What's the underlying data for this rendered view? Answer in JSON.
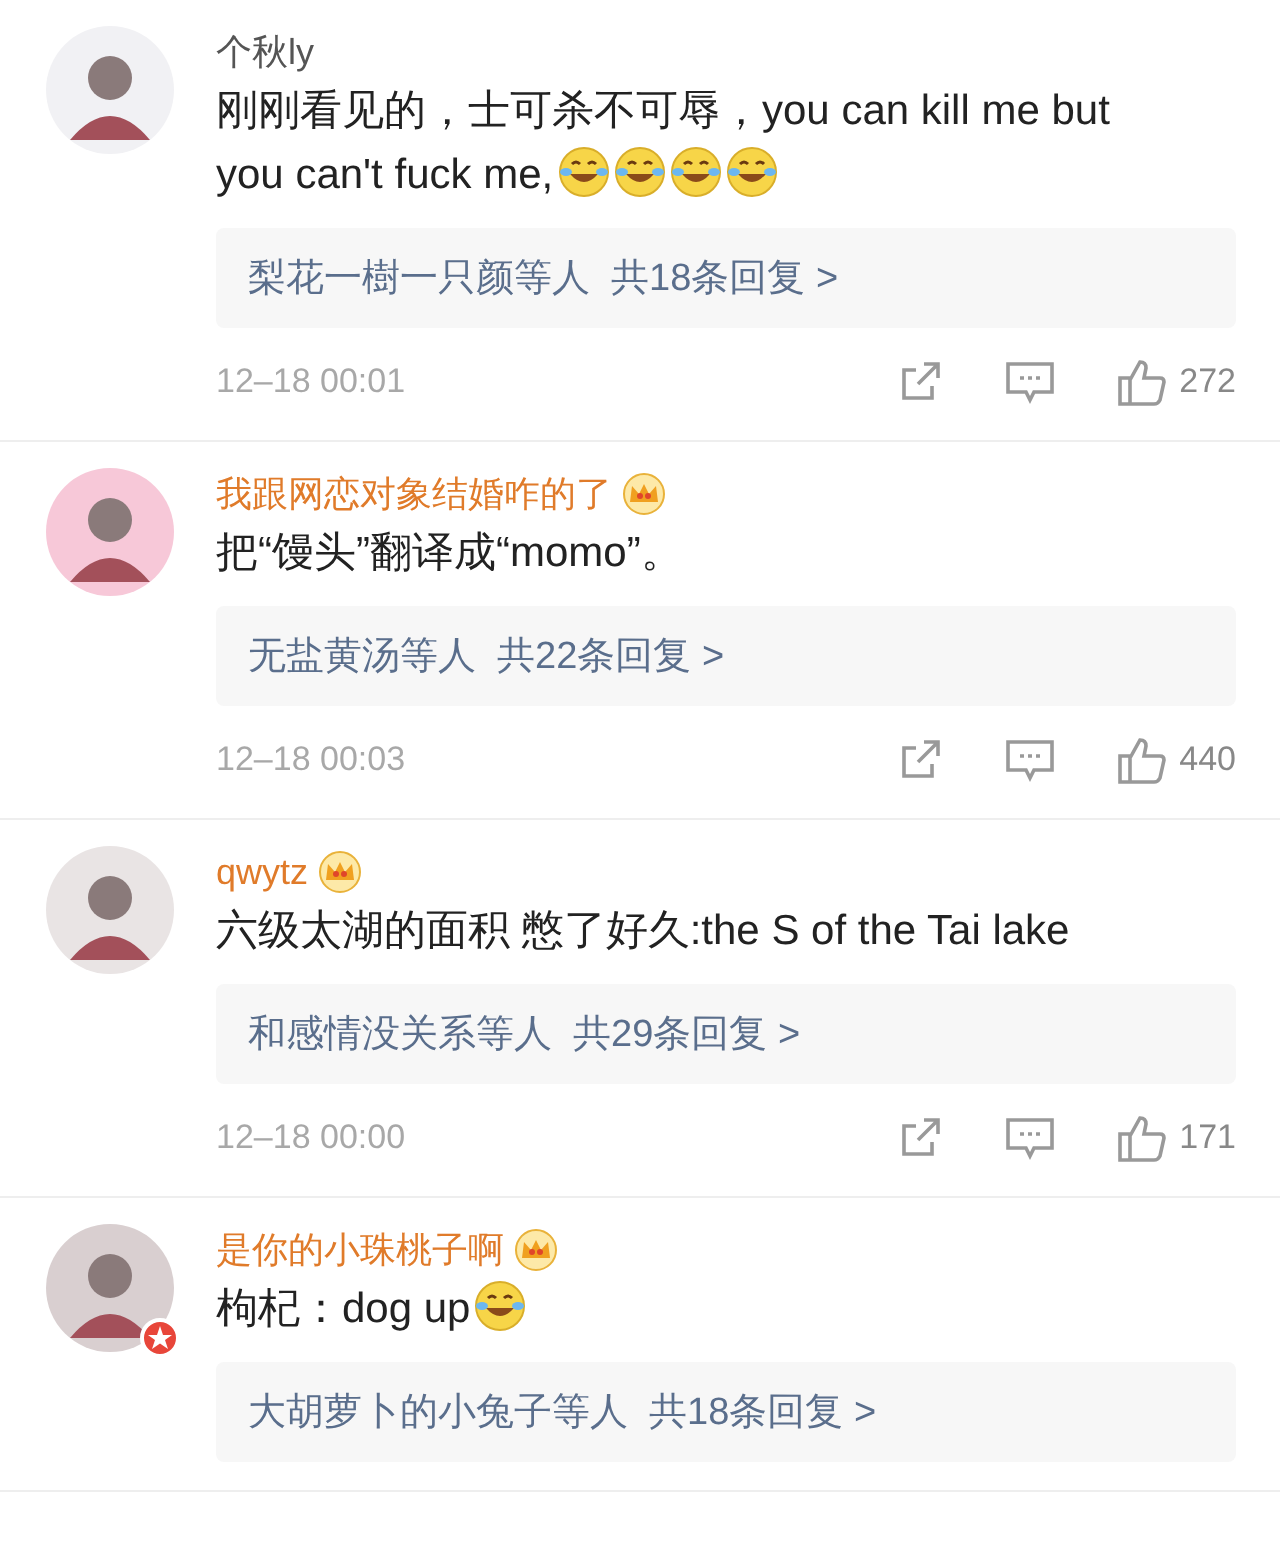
{
  "comments": [
    {
      "name": "个秋ly",
      "vip": false,
      "verified": false,
      "body": [
        {
          "kind": "text",
          "text": "刚刚看见的，士可杀不可辱，you can kill me but you can't fuck me,"
        },
        {
          "kind": "emoji"
        },
        {
          "kind": "emoji"
        },
        {
          "kind": "emoji"
        },
        {
          "kind": "emoji"
        }
      ],
      "replies": "梨花一樹一只颜等人  共18条回复 >",
      "time": "12–18 00:01",
      "likes": "272"
    },
    {
      "name": "我跟网恋对象结婚咋的了",
      "vip": true,
      "verified": false,
      "body": [
        {
          "kind": "text",
          "text": "把“馒头”翻译成“momo”。"
        }
      ],
      "replies": "无盐黄汤等人  共22条回复 >",
      "time": "12–18 00:03",
      "likes": "440"
    },
    {
      "name": "qwytz",
      "vip": true,
      "verified": false,
      "body": [
        {
          "kind": "text",
          "text": "六级太湖的面积 憋了好久:the S of the Tai lake"
        }
      ],
      "replies": "和感情没关系等人  共29条回复 >",
      "time": "12–18 00:00",
      "likes": "171"
    },
    {
      "name": "是你的小珠桃子啊",
      "vip": true,
      "verified": true,
      "body": [
        {
          "kind": "text",
          "text": "枸杞：dog up"
        },
        {
          "kind": "emoji"
        }
      ],
      "replies": "大胡萝卜的小兔子等人  共18条回复 >"
    }
  ]
}
